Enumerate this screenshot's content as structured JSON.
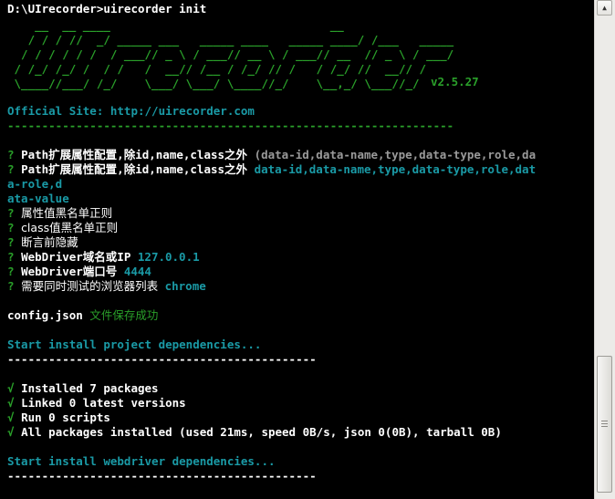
{
  "prompt_line": "D:\\UIrecorder>uirecorder init",
  "logo_lines": [
    "    __  __ ____                                __",
    "   / / / //  _/ _____ ___   _____ ____   _____ ____/ /___   _____",
    "  / / / / / /  / ___// _ \\ / ___// __ \\ / ___// __  // _ \\ / ___/",
    " / /_/ /_/ /  / /   /  __// /__ / /_/ // /   / /_/ //  __// /",
    " \\____//___/ /_/    \\___/ \\___/ \\____//_/    \\__,_/ \\___//_/"
  ],
  "version": "v2.5.27",
  "official_site_label": "Official Site: http://uirecorder.com",
  "separator_long": "-----------------------------------------------------------------",
  "q1": {
    "mark": "?",
    "label": "Path扩展属性配置,除id,name,class之外",
    "value": "(data-id,data-name,type,data-type,role,da"
  },
  "q2": {
    "mark": "?",
    "label": "Path扩展属性配置,除id,name,class之外",
    "value": "data-id,data-name,type,data-type,role,dat",
    "wrap1": "a-role,d",
    "wrap2": "ata-value"
  },
  "q3": {
    "mark": "?",
    "label": "属性值黑名单正则"
  },
  "q4": {
    "mark": "?",
    "label": "class值黑名单正则"
  },
  "q5": {
    "mark": "?",
    "label": "断言前隐藏"
  },
  "q6": {
    "mark": "?",
    "label": "WebDriver域名或IP",
    "value": "127.0.0.1"
  },
  "q7": {
    "mark": "?",
    "label": "WebDriver端口号",
    "value": "4444"
  },
  "q8": {
    "mark": "?",
    "label": "需要同时测试的浏览器列表",
    "value": "chrome"
  },
  "config_file": "config.json",
  "config_msg": "文件保存成功",
  "project_deps": "Start install project dependencies...",
  "separator_short": "---------------------------------------------",
  "results": [
    {
      "mark": "√",
      "text": "Installed 7 packages"
    },
    {
      "mark": "√",
      "text": "Linked 0 latest versions"
    },
    {
      "mark": "√",
      "text": "Run 0 scripts"
    },
    {
      "mark": "√",
      "text": "All packages installed (used 21ms, speed 0B/s, json 0(0B), tarball 0B)"
    }
  ],
  "webdriver_deps": "Start install webdriver dependencies...",
  "scroll_up_glyph": "▲",
  "colors": {
    "green": "#2aa02a",
    "cyan": "#1a9aa6",
    "white": "#ffffff",
    "background": "#000000"
  }
}
